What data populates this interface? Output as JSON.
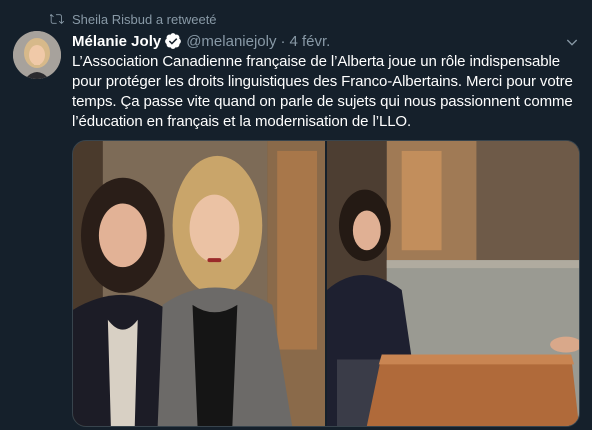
{
  "retweet": {
    "text": "Sheila Risbud a retweeté",
    "icon": "retweet-icon"
  },
  "author": {
    "name": "Mélanie Joly",
    "handle": "@melaniejoly",
    "verified": true,
    "separator": "·",
    "time": "4 févr."
  },
  "tweet": {
    "text": "L’Association Canadienne française de l’Alberta joue un rôle indispensable pour protéger les droits linguistiques des Franco-Albertains. Merci pour votre temps. Ça passe vite quand on parle de sujets qui nous passionnent comme l’éducation en français et la modernisation de l’LLO."
  },
  "media": {
    "count": 2,
    "photos": [
      "photo-two-women-portrait",
      "photo-meeting-lounge"
    ]
  },
  "colors": {
    "background": "#15202b",
    "secondary_text": "#8899a6",
    "verified_blue": "#1da1f2",
    "border": "#38444d"
  }
}
